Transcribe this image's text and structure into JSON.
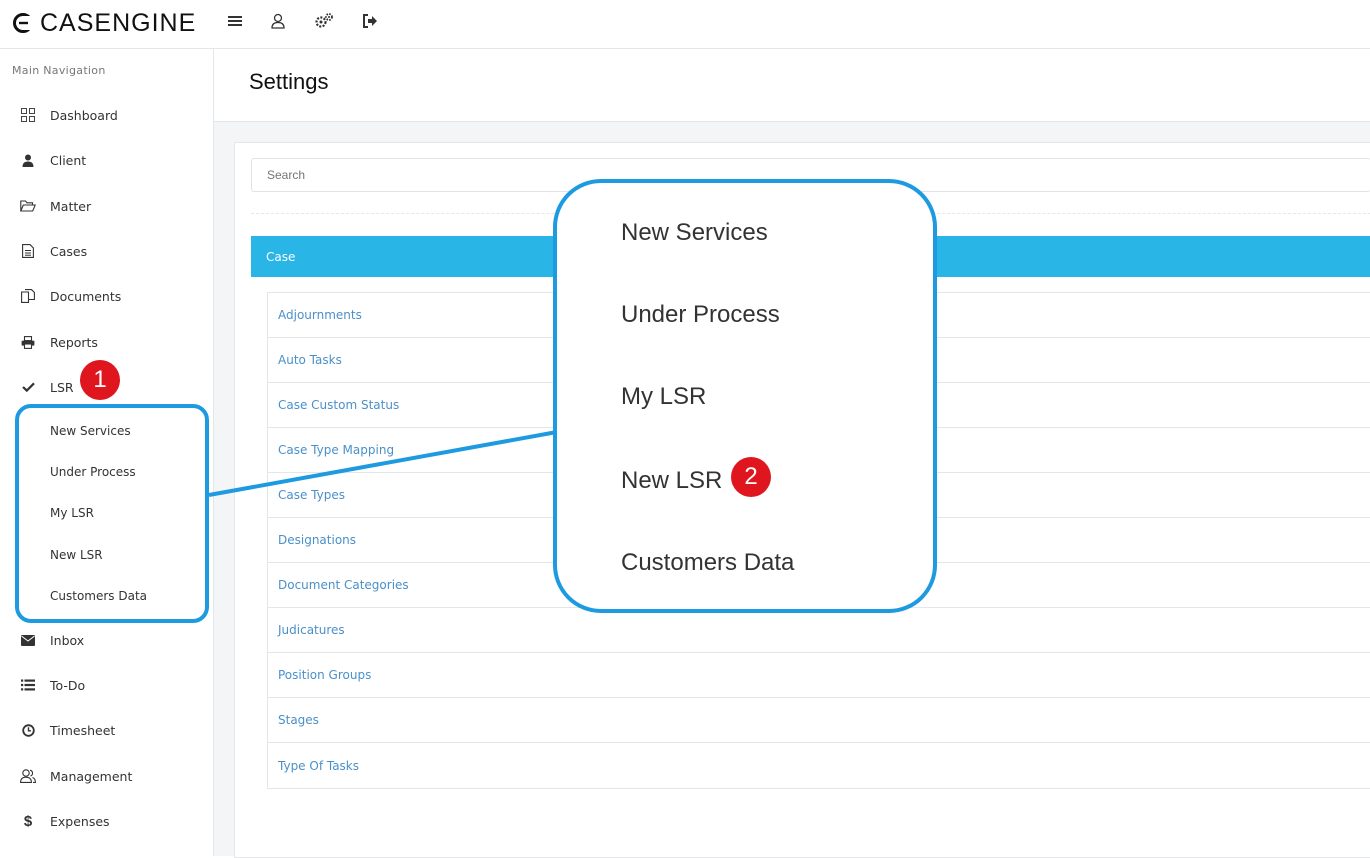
{
  "app": {
    "brand": "CASENGINE"
  },
  "toolbar": {
    "icons": [
      "menu-icon",
      "user-icon",
      "gears-icon",
      "sign-out-icon"
    ]
  },
  "sidebar": {
    "heading": "Main Navigation",
    "items": [
      {
        "label": "Dashboard",
        "icon": "grid-icon"
      },
      {
        "label": "Client",
        "icon": "user-solid-icon"
      },
      {
        "label": "Matter",
        "icon": "folder-open-icon"
      },
      {
        "label": "Cases",
        "icon": "document-icon"
      },
      {
        "label": "Documents",
        "icon": "copy-icon"
      },
      {
        "label": "Reports",
        "icon": "printer-icon"
      },
      {
        "label": "LSR",
        "icon": "check-icon"
      },
      {
        "label": "Inbox",
        "icon": "envelope-icon"
      },
      {
        "label": "To-Do",
        "icon": "list-icon"
      },
      {
        "label": "Timesheet",
        "icon": "clock-icon"
      },
      {
        "label": "Management",
        "icon": "users-icon"
      },
      {
        "label": "Expenses",
        "icon": "dollar-icon"
      }
    ],
    "lsr_submenu": [
      "New Services",
      "Under Process",
      "My LSR",
      "New LSR",
      "Customers Data"
    ]
  },
  "page": {
    "title": "Settings",
    "search_placeholder": "Search",
    "section_title": "Case",
    "settings_links": [
      "Adjournments",
      "Auto Tasks",
      "Case Custom Status",
      "Case Type Mapping",
      "Case Types",
      "Designations",
      "Document Categories",
      "Judicatures",
      "Position Groups",
      "Stages",
      "Type Of Tasks"
    ]
  },
  "callout": {
    "zoom_items": [
      "New Services",
      "Under Process",
      "My LSR",
      "New LSR",
      "Customers Data"
    ],
    "badge_1": "1",
    "badge_2": "2"
  },
  "colors": {
    "accent": "#29b6e6",
    "callout_border": "#1e9be0",
    "badge": "#e0161f",
    "link": "#4a90c9"
  }
}
